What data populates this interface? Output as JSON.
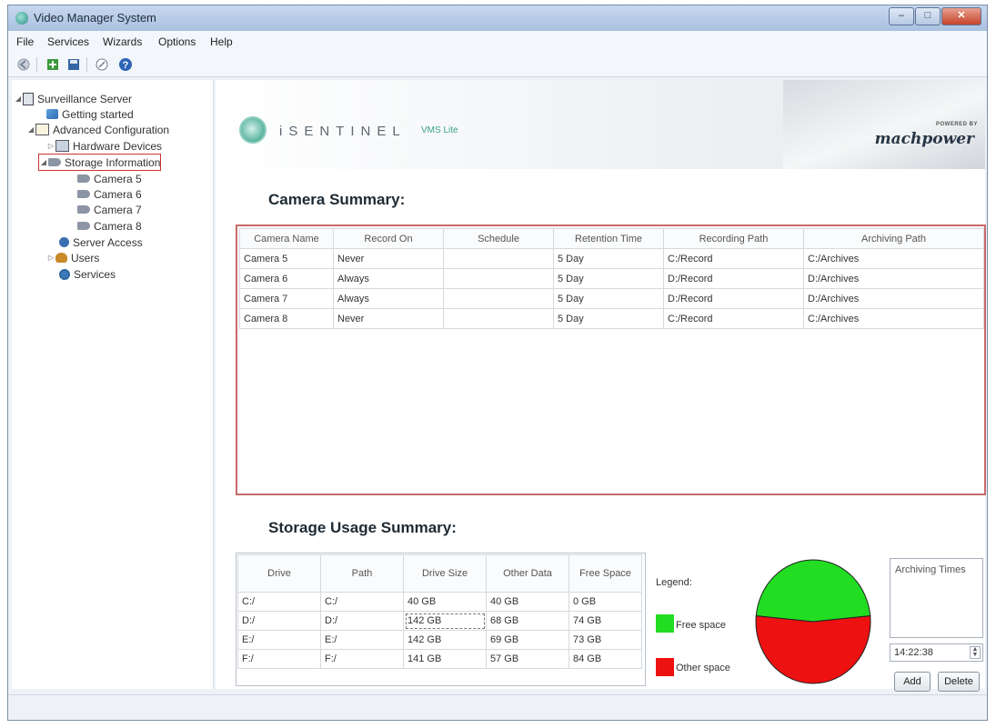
{
  "window": {
    "title": "Video Manager System",
    "min_label": "–",
    "max_label": "□",
    "close_label": "✕"
  },
  "menu": [
    "File",
    "Services",
    "Wizards",
    "Options",
    "Help"
  ],
  "toolbar": [
    "back-icon",
    "add-icon",
    "save-icon",
    "link-icon",
    "help-icon"
  ],
  "tree": {
    "root": "Surveillance Server",
    "getting_started": "Getting started",
    "advanced": "Advanced Configuration",
    "hardware": "Hardware Devices",
    "storage": "Storage Information",
    "cameras": [
      "Camera 5",
      "Camera 6",
      "Camera 7",
      "Camera 8"
    ],
    "server_access": "Server Access",
    "users": "Users",
    "services": "Services"
  },
  "banner": {
    "brand": "iSENTINEL",
    "sub": "VMS Lite",
    "powered": "POWERED BY",
    "mach": "machpower"
  },
  "camera_summary": {
    "title": "Camera Summary:",
    "headers": [
      "Camera Name",
      "Record On",
      "Schedule",
      "Retention Time",
      "Recording Path",
      "Archiving Path"
    ],
    "rows": [
      [
        "Camera 5",
        "Never",
        "",
        "5 Day",
        "C:/Record",
        "C:/Archives"
      ],
      [
        "Camera 6",
        "Always",
        "",
        "5 Day",
        "D:/Record",
        "D:/Archives"
      ],
      [
        "Camera 7",
        "Always",
        "",
        "5 Day",
        "D:/Record",
        "D:/Archives"
      ],
      [
        "Camera 8",
        "Never",
        "",
        "5 Day",
        "C:/Record",
        "C:/Archives"
      ]
    ]
  },
  "storage_summary": {
    "title": "Storage Usage Summary:",
    "headers": [
      "Drive",
      "Path",
      "Drive Size",
      "Other Data",
      "Free Space"
    ],
    "rows": [
      [
        "C:/",
        "C:/",
        "40 GB",
        "40 GB",
        "0 GB"
      ],
      [
        "D:/",
        "D:/",
        "142 GB",
        "68 GB",
        "74 GB"
      ],
      [
        "E:/",
        "E:/",
        "142 GB",
        "69 GB",
        "73 GB"
      ],
      [
        "F:/",
        "F:/",
        "141 GB",
        "57 GB",
        "84 GB"
      ]
    ]
  },
  "legend": {
    "title": "Legend:",
    "free": "Free space",
    "other": "Other space",
    "free_color": "#22dd22",
    "other_color": "#ee1111"
  },
  "pie": {
    "free_space_fraction": 0.47,
    "other_space_fraction": 0.53
  },
  "archiving": {
    "label": "Archiving Times",
    "time": "14:22:38",
    "add": "Add",
    "delete": "Delete"
  }
}
